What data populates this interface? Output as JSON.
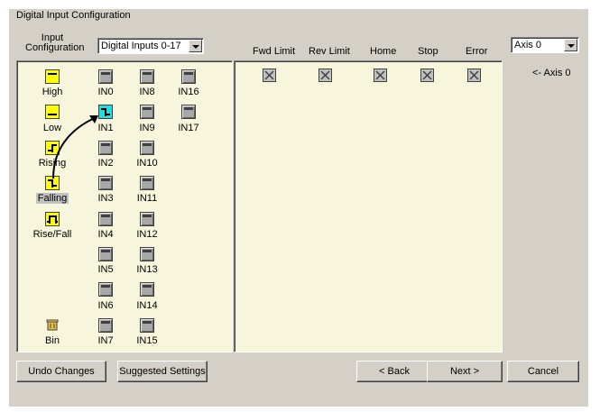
{
  "window": {
    "title": "Digital Input Configuration"
  },
  "input_config": {
    "label_line1": "Input",
    "label_line2": "Configuration",
    "selected": "Digital Inputs 0-17"
  },
  "modes": [
    {
      "label": "High",
      "icon": "high-level-icon"
    },
    {
      "label": "Low",
      "icon": "low-level-icon"
    },
    {
      "label": "Rising",
      "icon": "rising-edge-icon"
    },
    {
      "label": "Falling",
      "icon": "falling-edge-icon"
    },
    {
      "label": "Rise/Fall",
      "icon": "rise-fall-icon"
    },
    {
      "label": "Bin",
      "icon": "bin-icon"
    }
  ],
  "inputs": [
    "IN0",
    "IN1",
    "IN2",
    "IN3",
    "IN4",
    "IN5",
    "IN6",
    "IN7",
    "IN8",
    "IN9",
    "IN10",
    "IN11",
    "IN12",
    "IN13",
    "IN14",
    "IN15",
    "IN16",
    "IN17"
  ],
  "columns": [
    "Fwd Limit",
    "Rev Limit",
    "Home",
    "Stop",
    "Error"
  ],
  "axis": {
    "selected": "Axis 0",
    "row_label": "<- Axis 0"
  },
  "buttons": {
    "undo": "Undo Changes",
    "suggested": "Suggested Settings",
    "back": "< Back",
    "next": "Next >",
    "cancel": "Cancel"
  },
  "colors": {
    "panel": "#f7f5dc",
    "dialog": "#d4d0c8",
    "mode_icon": "#ffff00",
    "assigned_input": "#22dddd"
  }
}
